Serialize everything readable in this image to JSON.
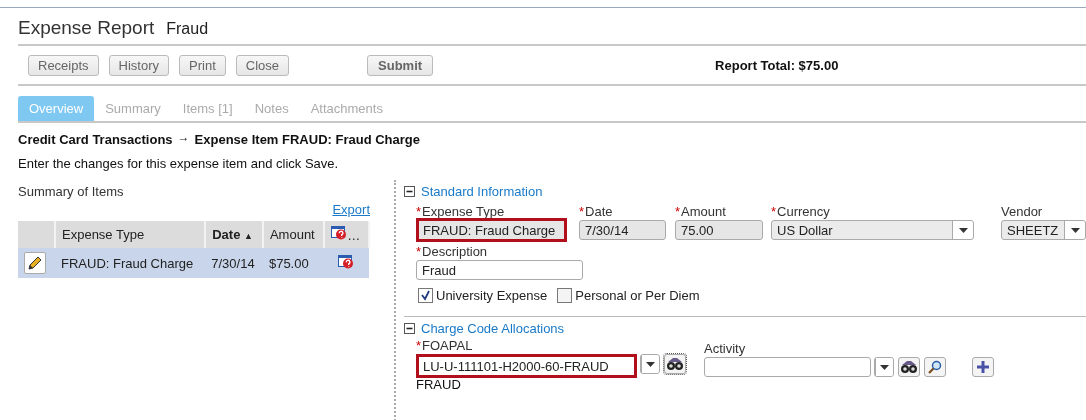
{
  "header": {
    "title": "Expense Report",
    "subtitle": "Fraud"
  },
  "toolbar": {
    "buttons": [
      {
        "label": "Receipts",
        "primary": false
      },
      {
        "label": "History",
        "primary": false
      },
      {
        "label": "Print",
        "primary": false
      },
      {
        "label": "Close",
        "primary": false
      },
      {
        "label": "Submit",
        "primary": true
      }
    ],
    "report_total": "Report Total: $75.00"
  },
  "tabs": [
    {
      "label": "Overview",
      "selected": true
    },
    {
      "label": "Summary",
      "selected": false
    },
    {
      "label": "Items [1]",
      "selected": false
    },
    {
      "label": "Notes",
      "selected": false
    },
    {
      "label": "Attachments",
      "selected": false
    }
  ],
  "breadcrumb": {
    "parent": "Credit Card Transactions",
    "separator": "→",
    "current": "Expense Item FRAUD: Fraud Charge"
  },
  "instruction": "Enter the changes for this expense item and click Save.",
  "summary": {
    "title": "Summary of Items",
    "export_link": "Export",
    "columns": [
      {
        "label": "Expense Type"
      },
      {
        "label": "Date",
        "sort": "▲"
      },
      {
        "label": "Amount"
      },
      {
        "label": "…"
      }
    ],
    "rows": [
      {
        "expense_type": "FRAUD: Fraud Charge",
        "date": "7/30/14",
        "amount": "$75.00",
        "selected": true
      }
    ]
  },
  "standard_information": {
    "title": "Standard Information",
    "expanded": true,
    "fields": [
      {
        "label": "Expense Type",
        "mark": "*",
        "value": "FRAUD: Fraud Charge",
        "kind": "readonly",
        "highlighted": true
      },
      {
        "label": "Date",
        "mark": "*",
        "value": "7/30/14",
        "kind": "readonly",
        "highlighted": false
      },
      {
        "label": "Amount",
        "mark": "*",
        "value": "75.00",
        "kind": "readonly",
        "highlighted": false
      },
      {
        "label": "Currency",
        "mark": "*",
        "value": "US Dollar",
        "kind": "select",
        "highlighted": false
      },
      {
        "label": "Vendor",
        "value": "SHEETZ",
        "kind": "select",
        "highlighted": false
      }
    ],
    "description": {
      "label": "Description",
      "mark": "*",
      "value": "Fraud"
    },
    "checkboxes": [
      {
        "label": "University Expense",
        "checked": true
      },
      {
        "label": "Personal or Per Diem",
        "checked": false
      }
    ]
  },
  "charge_code_allocations": {
    "title": "Charge Code Allocations",
    "expanded": true,
    "foapal": {
      "label": "FOAPAL",
      "mark": "*",
      "value": "LU-U-111101-H2000-60-FRAUD",
      "highlighted": true,
      "note": "FRAUD"
    },
    "activity": {
      "label": "Activity"
    }
  }
}
